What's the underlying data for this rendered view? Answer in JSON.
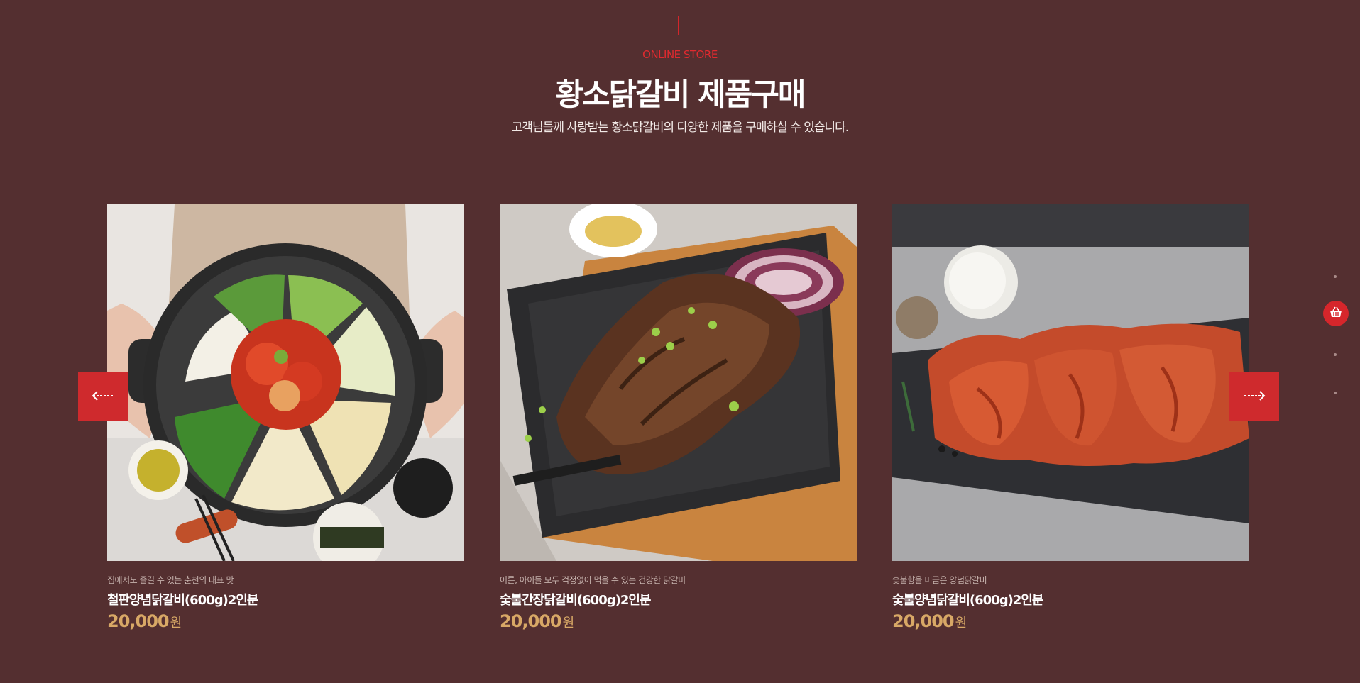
{
  "section": {
    "eyebrow": "ONLINE STORE",
    "title": "황소닭갈비 제품구매",
    "subtitle": "고객님들께 사랑받는 황소닭갈비의 다양한 제품을 구매하실 수 있습니다."
  },
  "products": [
    {
      "tagline": "집에서도 즐길 수 있는 춘천의 대표 맛",
      "name": "철판양념닭갈비(600g)2인분",
      "price": "20,000",
      "unit": "원"
    },
    {
      "tagline": "어른, 아이들 모두 걱정없이 먹을 수 있는 건강한 닭갈비",
      "name": "숯불간장닭갈비(600g)2인분",
      "price": "20,000",
      "unit": "원"
    },
    {
      "tagline": "숯불향을 머금은 양념닭갈비",
      "name": "숯불양념닭갈비(600g)2인분",
      "price": "20,000",
      "unit": "원"
    }
  ],
  "icons": {
    "prev": "arrow-left-icon",
    "next": "arrow-right-icon",
    "cart": "basket-icon"
  },
  "colors": {
    "background": "#542f30",
    "accent": "#d3262b",
    "price": "#d8a866"
  }
}
